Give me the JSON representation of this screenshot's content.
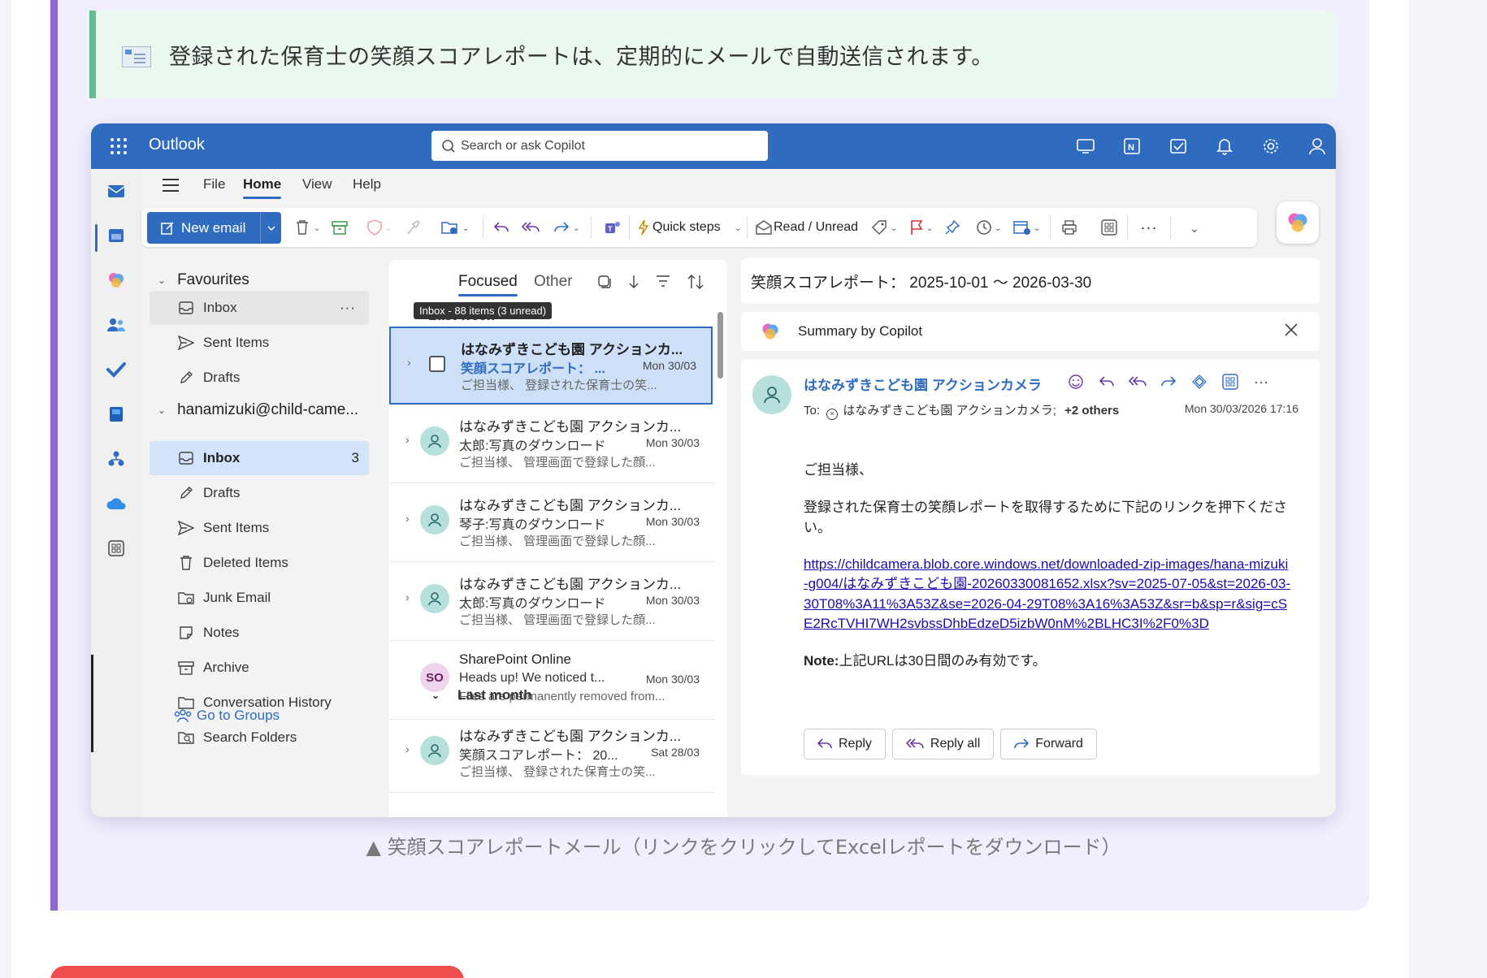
{
  "info_box": {
    "text": "登録された保育士の笑顔スコアレポートは、定期的にメールで自動送信されます。"
  },
  "outlook": {
    "app_title": "Outlook",
    "search": {
      "placeholder": "Search or ask Copilot"
    },
    "menu": {
      "file": "File",
      "home": "Home",
      "view": "View",
      "help": "Help"
    },
    "ribbon": {
      "new_email": "New email",
      "quick_steps": "Quick steps",
      "read_unread": "Read / Unread"
    },
    "nav": {
      "favourites": "Favourites",
      "fav_items": [
        {
          "label": "Inbox",
          "icon": "inbox-icon"
        },
        {
          "label": "Sent Items",
          "icon": "send-icon"
        },
        {
          "label": "Drafts",
          "icon": "pencil-icon"
        }
      ],
      "account": "hanamizuki@child-came...",
      "account_items": [
        {
          "label": "Inbox",
          "count": "3",
          "icon": "inbox-icon"
        },
        {
          "label": "Drafts",
          "icon": "pencil-icon"
        },
        {
          "label": "Sent Items",
          "icon": "send-icon"
        },
        {
          "label": "Deleted Items",
          "icon": "trash-icon"
        },
        {
          "label": "Junk Email",
          "icon": "junk-folder-icon"
        },
        {
          "label": "Notes",
          "icon": "note-icon"
        },
        {
          "label": "Archive",
          "icon": "archive-icon"
        },
        {
          "label": "Conversation History",
          "icon": "folder-icon"
        },
        {
          "label": "Search Folders",
          "icon": "search-folder-icon"
        }
      ],
      "go_to_groups": "Go to Groups"
    },
    "list": {
      "tab_focused": "Focused",
      "tab_other": "Other",
      "tooltip": "Inbox - 88 items (3 unread)",
      "group_last_week": "Last week",
      "group_last_month": "Last month",
      "messages": [
        {
          "sender": "はなみずきこども園 アクションカ...",
          "subject": "笑顔スコアレポート： ...",
          "date": "Mon 30/03",
          "preview": "ご担当様、 登録された保育士の笑...",
          "unread": true,
          "selected": true
        },
        {
          "sender": "はなみずきこども園 アクションカ...",
          "subject": "太郎:写真のダウンロード",
          "date": "Mon 30/03",
          "preview": "ご担当様、 管理画面で登録した顔..."
        },
        {
          "sender": "はなみずきこども園 アクションカ...",
          "subject": "琴子:写真のダウンロード",
          "date": "Mon 30/03",
          "preview": "ご担当様、 管理画面で登録した顔..."
        },
        {
          "sender": "はなみずきこども園 アクションカ...",
          "subject": "太郎:写真のダウンロード",
          "date": "Mon 30/03",
          "preview": "ご担当様、 管理画面で登録した顔..."
        },
        {
          "sender": "SharePoint Online",
          "subject": "Heads up! We noticed t...",
          "date": "Mon 30/03",
          "preview": "Files are permanently removed from...",
          "avatar_text": "SO"
        },
        {
          "sender": "はなみずきこども園 アクションカ...",
          "subject": "笑顔スコアレポート： 20...",
          "date": "Sat 28/03",
          "preview": "ご担当様、 登録された保育士の笑..."
        }
      ]
    },
    "reading": {
      "subject": "笑顔スコアレポート： 2025-10-01 〜 2026-03-30",
      "summary_label": "Summary by Copilot",
      "from": "はなみずきこども園 アクションカメラ",
      "to_prefix": "To:",
      "to_name": "はなみずきこども園 アクションカメラ;",
      "to_more": "+2 others",
      "timestamp": "Mon 30/03/2026 17:16",
      "greeting": "ご担当様、",
      "body_line": "登録された保育士の笑顔レポートを取得するために下記のリンクを押下ください。",
      "link": "https://childcamera.blob.core.windows.net/downloaded-zip-images/hana-mizuki-g004/はなみずきこども園-20260330081652.xlsx?sv=2025-07-05&st=2026-03-30T08%3A11%3A53Z&se=2026-04-29T08%3A16%3A53Z&sr=b&sp=r&sig=cSE2RcTVHI7WH2svbssDhbEdzeD5izbW0nM%2BLHC3I%2F0%3D",
      "note_label": "Note:",
      "note_text": "上記URLは30日間のみ有効です。",
      "reply": "Reply",
      "reply_all": "Reply all",
      "forward": "Forward"
    }
  },
  "caption": "▲ 笑顔スコアレポートメール（リンクをクリックしてExcelレポートをダウンロード）"
}
